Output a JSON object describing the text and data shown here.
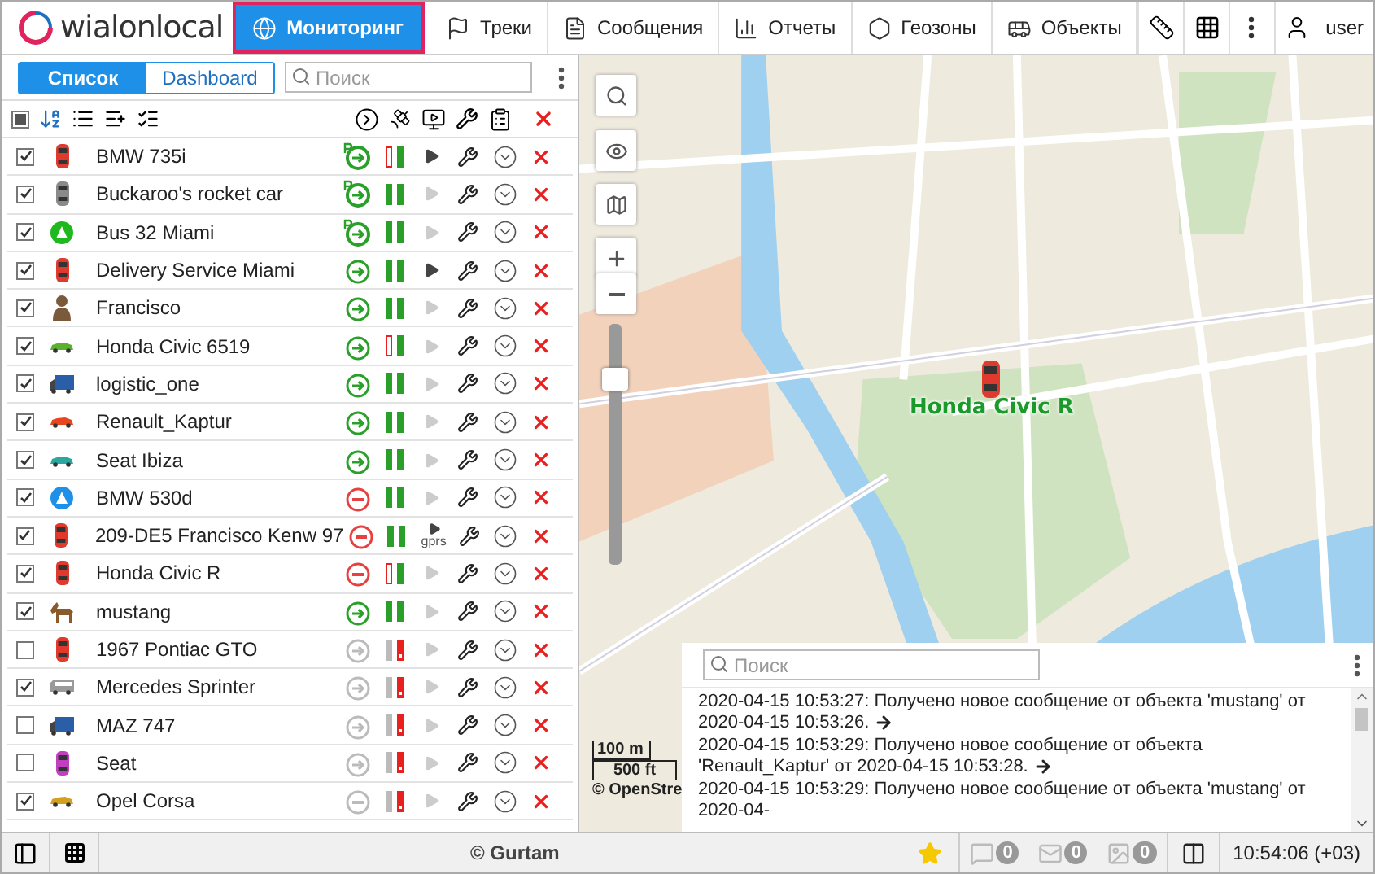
{
  "header": {
    "logo": "wialonlocal",
    "tabs": [
      {
        "label": "Мониторинг",
        "kind": "globe",
        "selected": true
      },
      {
        "label": "Треки",
        "kind": "flag",
        "selected": false
      },
      {
        "label": "Сообщения",
        "kind": "messages",
        "selected": false
      },
      {
        "label": "Отчеты",
        "kind": "reports",
        "selected": false
      },
      {
        "label": "Геозоны",
        "kind": "geofence",
        "selected": false
      },
      {
        "label": "Объекты",
        "kind": "units",
        "selected": false
      }
    ],
    "user": "user"
  },
  "panel": {
    "views": [
      {
        "label": "Список",
        "selected": true
      },
      {
        "label": "Dashboard",
        "selected": false
      }
    ],
    "search": {
      "placeholder": "Поиск"
    },
    "select_all_partial": true,
    "rows": [
      {
        "checked": true,
        "name": "BMW 735i",
        "kind": "car",
        "color": "#e03a2f",
        "online": true,
        "moving": true,
        "parked": true,
        "gps_valid": false,
        "command_available": true
      },
      {
        "checked": true,
        "name": "Buckaroo's rocket car",
        "kind": "car",
        "color": "#8a8a8a",
        "online": true,
        "moving": true,
        "parked": true,
        "gps_valid": true,
        "command_available": false
      },
      {
        "checked": true,
        "name": "Bus 32 Miami",
        "kind": "badge",
        "color": "#1fb81f",
        "online": true,
        "moving": true,
        "parked": true,
        "gps_valid": true,
        "command_available": false
      },
      {
        "checked": true,
        "name": "Delivery Service Miami",
        "kind": "car",
        "color": "#e03a2f",
        "online": true,
        "moving": true,
        "parked": false,
        "gps_valid": true,
        "command_available": true
      },
      {
        "checked": true,
        "name": "Francisco",
        "kind": "person",
        "color": "#7a5a3a",
        "online": true,
        "moving": true,
        "parked": false,
        "gps_valid": true,
        "command_available": false
      },
      {
        "checked": true,
        "name": "Honda Civic 6519",
        "kind": "sidecar",
        "color": "#5cb030",
        "online": true,
        "moving": true,
        "parked": false,
        "gps_valid": false,
        "command_available": false
      },
      {
        "checked": true,
        "name": "logistic_one",
        "kind": "truck",
        "color": "#2a5fa8",
        "online": true,
        "moving": true,
        "parked": false,
        "gps_valid": true,
        "command_available": false
      },
      {
        "checked": true,
        "name": "Renault_Kaptur",
        "kind": "sidecar",
        "color": "#e8461e",
        "online": true,
        "moving": true,
        "parked": false,
        "gps_valid": true,
        "command_available": false
      },
      {
        "checked": true,
        "name": "Seat Ibiza",
        "kind": "sidecar",
        "color": "#2aa8a0",
        "online": true,
        "moving": true,
        "parked": false,
        "gps_valid": true,
        "command_available": false
      },
      {
        "checked": true,
        "name": "BMW 530d",
        "kind": "badge",
        "color": "#1e90e8",
        "online": true,
        "moving": false,
        "parked": false,
        "gps_valid": true,
        "command_available": false
      },
      {
        "checked": true,
        "name": "209-DE5 Francisco Kenw 97",
        "kind": "car",
        "color": "#e03a2f",
        "online": true,
        "moving": false,
        "parked": false,
        "gps_valid": true,
        "command_available": true,
        "command_label": "gprs"
      },
      {
        "checked": true,
        "name": "Honda Civic R",
        "kind": "car",
        "color": "#e03a2f",
        "online": true,
        "moving": false,
        "parked": false,
        "gps_valid": false,
        "command_available": false
      },
      {
        "checked": true,
        "name": "mustang",
        "kind": "horse",
        "color": "#8a5a2a",
        "online": true,
        "moving": true,
        "parked": false,
        "gps_valid": true,
        "command_available": false
      },
      {
        "checked": false,
        "name": "1967 Pontiac GTO",
        "kind": "car",
        "color": "#e03a2f",
        "online": false,
        "moving": true,
        "parked": false,
        "gps_valid": true,
        "command_available": false
      },
      {
        "checked": true,
        "name": "Mercedes Sprinter",
        "kind": "van",
        "color": "#9a9a9a",
        "online": false,
        "moving": true,
        "parked": false,
        "gps_valid": true,
        "command_available": false
      },
      {
        "checked": false,
        "name": "MAZ 747",
        "kind": "truck",
        "color": "#2a5fa8",
        "online": false,
        "moving": true,
        "parked": false,
        "gps_valid": true,
        "command_available": false
      },
      {
        "checked": false,
        "name": "Seat",
        "kind": "car",
        "color": "#c040c0",
        "online": false,
        "moving": true,
        "parked": false,
        "gps_valid": true,
        "command_available": false
      },
      {
        "checked": true,
        "name": "Opel Corsa",
        "kind": "sidecar",
        "color": "#d4a020",
        "online": false,
        "moving": false,
        "parked": false,
        "gps_valid": true,
        "command_available": false
      }
    ]
  },
  "map": {
    "marker": {
      "label": "Honda Civic R"
    },
    "zoom": {
      "level": 0.8
    },
    "scale": {
      "metric": "100 m",
      "imperial": "500 ft"
    },
    "attribution": "© OpenStre",
    "log": {
      "search": {
        "placeholder": "Поиск"
      },
      "messages": [
        "2020-04-15 10:53:27: Получено новое сообщение от объекта 'mustang' от 2020-04-15 10:53:26.",
        "2020-04-15 10:53:29: Получено новое сообщение от объекта 'Renault_Kaptur' от 2020-04-15 10:53:28.",
        "2020-04-15 10:53:29: Получено новое сообщение от объекта 'mustang' от 2020-04-"
      ]
    }
  },
  "status_bar": {
    "copyright": "© Gurtam",
    "counters": [
      {
        "kind": "messages",
        "count": "0"
      },
      {
        "kind": "mail",
        "count": "0"
      },
      {
        "kind": "images",
        "count": "0"
      }
    ],
    "time": "10:54:06 (+03)"
  }
}
